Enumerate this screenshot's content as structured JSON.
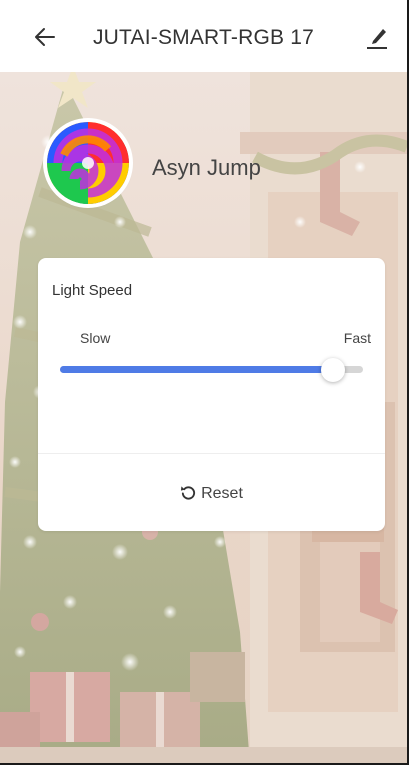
{
  "header": {
    "title": "JUTAI-SMART-RGB 17",
    "back_icon": "arrow-left-icon",
    "edit_icon": "pencil-icon"
  },
  "mode": {
    "name": "Asyn Jump",
    "icon": "color-swirl-icon"
  },
  "speed_card": {
    "title": "Light Speed",
    "min_label": "Slow",
    "max_label": "Fast",
    "value_fraction": 0.9,
    "reset_label": "Reset",
    "reset_icon": "rotate-left-icon"
  },
  "colors": {
    "accent": "#4f7be6",
    "track": "#d6d6d6",
    "card": "#ffffff"
  }
}
